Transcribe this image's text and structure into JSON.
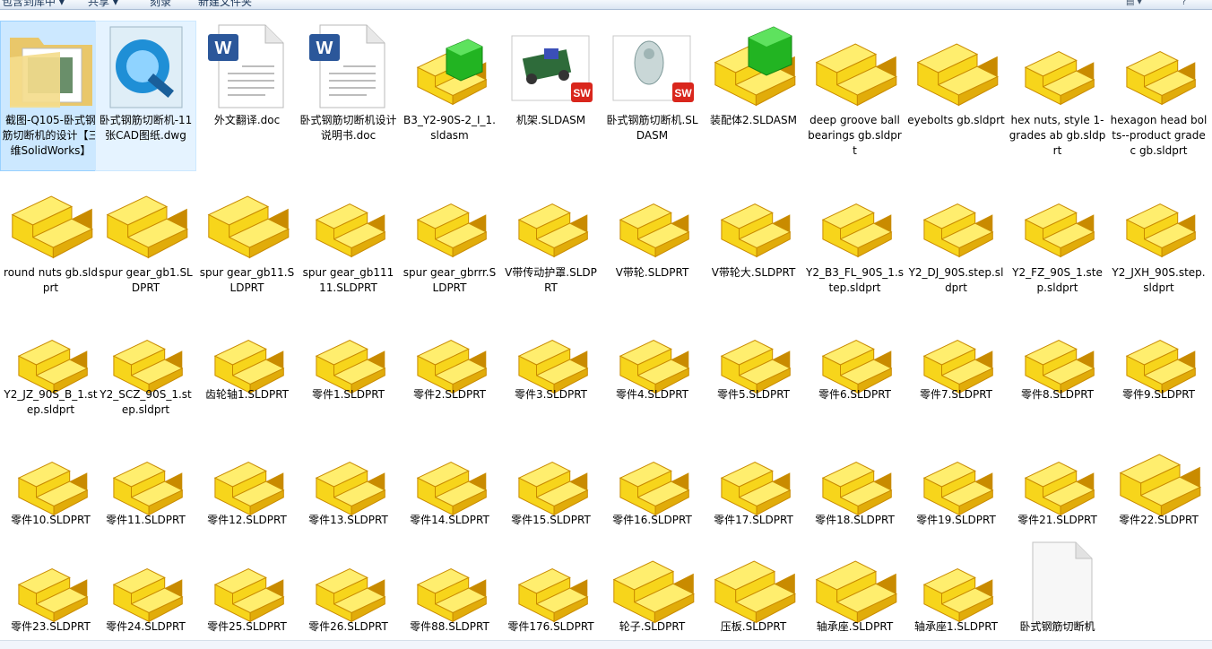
{
  "toolbar": {
    "items": [
      "包含到库中 ▾",
      "共享 ▾",
      "刻录",
      "新建文件夹"
    ]
  },
  "files": [
    {
      "name": "截图-Q105-卧式钢筋切断机的设计【三维SolidWorks】",
      "icon": "folder-icon",
      "state": "selected"
    },
    {
      "name": "卧式钢筋切断机-11张CAD图纸.dwg",
      "icon": "dwg-icon",
      "state": "hover"
    },
    {
      "name": "外文翻译.doc",
      "icon": "word-doc-icon"
    },
    {
      "name": "卧式钢筋切断机设计说明书.doc",
      "icon": "word-doc-icon"
    },
    {
      "name": "B3_Y2-90S-2_I_1.sldasm",
      "icon": "assembly-icon"
    },
    {
      "name": "机架.SLDASM",
      "icon": "sw-thumbnail-frame-icon"
    },
    {
      "name": "卧式钢筋切断机.SLDASM",
      "icon": "sw-thumbnail-machine-icon"
    },
    {
      "name": "装配体2.SLDASM",
      "icon": "assembly-large-icon"
    },
    {
      "name": "deep groove ball bearings gb.sldprt",
      "icon": "part-large-icon"
    },
    {
      "name": "eyebolts gb.sldprt",
      "icon": "part-large-icon"
    },
    {
      "name": "hex nuts, style 1-grades ab gb.sldprt",
      "icon": "part-icon"
    },
    {
      "name": "hexagon head bolts--product grade c gb.sldprt",
      "icon": "part-icon"
    },
    {
      "name": "round nuts gb.sldprt",
      "icon": "part-large-icon"
    },
    {
      "name": "spur gear_gb1.SLDPRT",
      "icon": "part-large-icon"
    },
    {
      "name": "spur gear_gb11.SLDPRT",
      "icon": "part-large-icon"
    },
    {
      "name": "spur gear_gb11111.SLDPRT",
      "icon": "part-icon"
    },
    {
      "name": "spur gear_gbrrr.SLDPRT",
      "icon": "part-icon"
    },
    {
      "name": "V带传动护罩.SLDPRT",
      "icon": "part-icon"
    },
    {
      "name": "V带轮.SLDPRT",
      "icon": "part-icon"
    },
    {
      "name": "V带轮大.SLDPRT",
      "icon": "part-icon"
    },
    {
      "name": "Y2_B3_FL_90S_1.step.sldprt",
      "icon": "part-icon"
    },
    {
      "name": "Y2_DJ_90S.step.sldprt",
      "icon": "part-icon"
    },
    {
      "name": "Y2_FZ_90S_1.step.sldprt",
      "icon": "part-icon"
    },
    {
      "name": "Y2_JXH_90S.step.sldprt",
      "icon": "part-icon"
    },
    {
      "name": "Y2_JZ_90S_B_1.step.sldprt",
      "icon": "part-icon"
    },
    {
      "name": "Y2_SCZ_90S_1.step.sldprt",
      "icon": "part-icon"
    },
    {
      "name": "齿轮轴1.SLDPRT",
      "icon": "part-icon"
    },
    {
      "name": "零件1.SLDPRT",
      "icon": "part-icon"
    },
    {
      "name": "零件2.SLDPRT",
      "icon": "part-icon"
    },
    {
      "name": "零件3.SLDPRT",
      "icon": "part-icon"
    },
    {
      "name": "零件4.SLDPRT",
      "icon": "part-icon"
    },
    {
      "name": "零件5.SLDPRT",
      "icon": "part-icon"
    },
    {
      "name": "零件6.SLDPRT",
      "icon": "part-icon"
    },
    {
      "name": "零件7.SLDPRT",
      "icon": "part-icon"
    },
    {
      "name": "零件8.SLDPRT",
      "icon": "part-icon"
    },
    {
      "name": "零件9.SLDPRT",
      "icon": "part-icon"
    },
    {
      "name": "零件10.SLDPRT",
      "icon": "part-icon"
    },
    {
      "name": "零件11.SLDPRT",
      "icon": "part-icon"
    },
    {
      "name": "零件12.SLDPRT",
      "icon": "part-icon"
    },
    {
      "name": "零件13.SLDPRT",
      "icon": "part-icon"
    },
    {
      "name": "零件14.SLDPRT",
      "icon": "part-icon"
    },
    {
      "name": "零件15.SLDPRT",
      "icon": "part-icon"
    },
    {
      "name": "零件16.SLDPRT",
      "icon": "part-icon"
    },
    {
      "name": "零件17.SLDPRT",
      "icon": "part-icon"
    },
    {
      "name": "零件18.SLDPRT",
      "icon": "part-icon"
    },
    {
      "name": "零件19.SLDPRT",
      "icon": "part-icon"
    },
    {
      "name": "零件21.SLDPRT",
      "icon": "part-icon"
    },
    {
      "name": "零件22.SLDPRT",
      "icon": "part-large-icon"
    },
    {
      "name": "零件23.SLDPRT",
      "icon": "part-icon"
    },
    {
      "name": "零件24.SLDPRT",
      "icon": "part-icon"
    },
    {
      "name": "零件25.SLDPRT",
      "icon": "part-icon"
    },
    {
      "name": "零件26.SLDPRT",
      "icon": "part-icon"
    },
    {
      "name": "零件88.SLDPRT",
      "icon": "part-icon"
    },
    {
      "name": "零件176.SLDPRT",
      "icon": "part-icon"
    },
    {
      "name": "轮子.SLDPRT",
      "icon": "part-large-icon"
    },
    {
      "name": "压板.SLDPRT",
      "icon": "part-large-icon"
    },
    {
      "name": "轴承座.SLDPRT",
      "icon": "part-large-icon"
    },
    {
      "name": "轴承座1.SLDPRT",
      "icon": "part-icon"
    },
    {
      "name": "卧式钢筋切断机",
      "icon": "blank-file-icon"
    }
  ],
  "colors": {
    "part_yellow": "#f7d51b",
    "part_light": "#ffee6e",
    "part_dark": "#e1ac0a",
    "part_edge": "#c98b00",
    "green_cube": "#22b422",
    "selection_bg": "#cce8ff",
    "selection_border": "#99d1ff",
    "word_blue": "#2b579a"
  }
}
